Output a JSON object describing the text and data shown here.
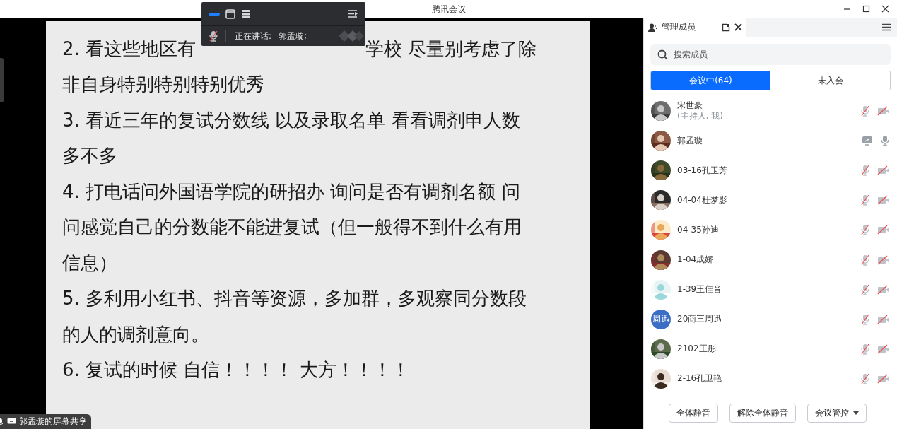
{
  "window": {
    "title": "腾讯会议"
  },
  "floating_toolbar": {
    "speaking_label": "正在讲话:",
    "speaker": "郭孟璇;",
    "mic_muted": true
  },
  "shared_screen": {
    "label": "郭孟璇的屏幕共享",
    "lines": [
      {
        "segments": [
          "2. 看这些地区有",
          "学校 尽量别考虑了除"
        ]
      },
      {
        "segments": [
          "非自身特别特别特别优秀"
        ]
      },
      {
        "segments": [
          "3. 看近三年的复试分数线 以及录取名单 看看调剂申人数"
        ]
      },
      {
        "segments": [
          "多不多"
        ]
      },
      {
        "segments": [
          "4. 打电话问外国语学院的研招办 询问是否有调剂名额 问"
        ]
      },
      {
        "segments": [
          "问感觉自己的分数能不能进复试（但一般得不到什么有用"
        ]
      },
      {
        "segments": [
          "信息）"
        ]
      },
      {
        "segments": [
          "5. 多利用小红书、抖音等资源，多加群，多观察同分数段"
        ]
      },
      {
        "segments": [
          "的人的调剂意向。"
        ]
      },
      {
        "segments": [
          "6. 复试的时候 自信！！！！ 大方！！！！"
        ]
      }
    ]
  },
  "panel": {
    "title": "管理成员",
    "search": {
      "placeholder": "搜索成员"
    },
    "tabs": [
      {
        "label": "会议中(64)",
        "selected": true
      },
      {
        "label": "未入会",
        "selected": false
      }
    ],
    "members": [
      {
        "name": "宋世豪",
        "note": "(主持人, 我)",
        "sharing": false,
        "mic_muted": true,
        "camera_off": true
      },
      {
        "name": "郭孟璇",
        "sharing": true,
        "mic_muted": false
      },
      {
        "name": "03-16孔玉芳",
        "sharing": false,
        "mic_muted": true,
        "camera_off": true
      },
      {
        "name": "04-04杜梦影",
        "sharing": false,
        "mic_muted": true,
        "camera_off": true
      },
      {
        "name": "04-35孙迪",
        "sharing": false,
        "mic_muted": true,
        "camera_off": true
      },
      {
        "name": "1-04成娇",
        "sharing": false,
        "mic_muted": true,
        "camera_off": true
      },
      {
        "name": "1-39王佳音",
        "sharing": false,
        "mic_muted": true,
        "camera_off": true
      },
      {
        "name": "20商三周迅",
        "avatar": {
          "kind": "initials",
          "text": "周迅"
        },
        "sharing": false,
        "mic_muted": true,
        "camera_off": true
      },
      {
        "name": "2102王彤",
        "sharing": false,
        "mic_muted": true,
        "camera_off": true
      },
      {
        "name": "2-16孔卫艳",
        "sharing": false,
        "mic_muted": true,
        "camera_off": true
      }
    ],
    "buttons": [
      {
        "label": "全体静音",
        "dropdown": false
      },
      {
        "label": "解除全体静音",
        "dropdown": false
      },
      {
        "label": "会议管控",
        "dropdown": true
      }
    ]
  }
}
